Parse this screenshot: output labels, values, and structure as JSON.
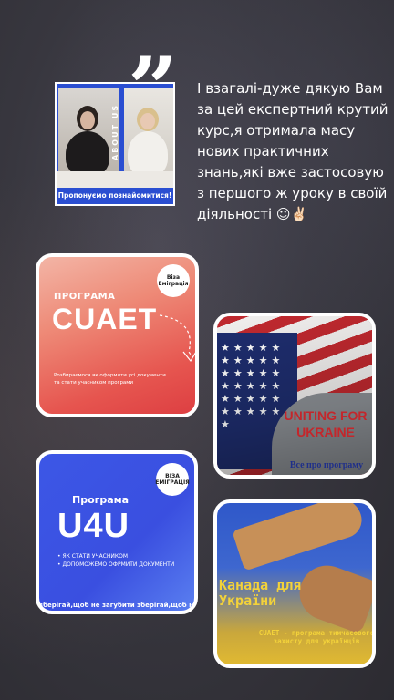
{
  "testimonial": {
    "photo_caption": "Пропонуємо познайомитися!",
    "photo_vertical_label": "ABOUT US",
    "quote_mark": "”",
    "text": "І взагалі-дуже дякую Вам за цей експертний крутий курс,я отримала масу нових практичних знань,які вже застосовую з першого ж уроку в своїй діяльності ☺✌🏻"
  },
  "cards": {
    "cuaet": {
      "badge": "Віза Еміграція",
      "program_label": "ПРОГРАМА",
      "title": "CUAET",
      "description": "Розбираємося як оформити усі документи та стати учасником програми"
    },
    "flag": {
      "title": "UNITING FOR UKRAINE",
      "subtitle": "Все про програму"
    },
    "u4u": {
      "badge": "ВІЗА ЕМІГРАЦІЯ",
      "program_label": "Програма",
      "title": "U4U",
      "list": [
        "ЯК СТАТИ УЧАСНИКОМ",
        "ДОПОМОЖЕМО ОФРМИТИ ДОКУМЕНТИ"
      ],
      "footer": "зберігай,щоб не загубити  зберігай,щоб не загубити"
    },
    "canada": {
      "title_line1": "Канада для",
      "title_line2": "України",
      "subtitle": "CUAET - програма тимчасового захисту для українців"
    }
  },
  "colors": {
    "background": "#38373f",
    "photo_blue": "#2a4ed1",
    "flag_red": "#c4262b",
    "canada_yellow": "#f3d23a"
  }
}
